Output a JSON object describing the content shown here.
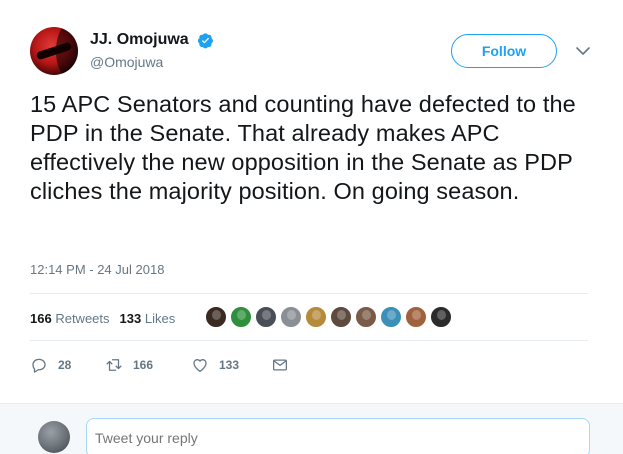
{
  "user": {
    "display_name": "JJ. Omojuwa",
    "handle": "@Omojuwa",
    "verified": true
  },
  "follow_label": "Follow",
  "tweet": {
    "text": "15 APC Senators and counting have defected to the PDP in the Senate. That already makes APC effectively the new opposition in the Senate as PDP cliches the majority position. On going season.",
    "timestamp": "12:14 PM - 24 Jul 2018"
  },
  "stats": {
    "retweets_count": "166",
    "retweets_label": "Retweets",
    "likes_count": "133",
    "likes_label": "Likes"
  },
  "liker_faces": [
    {
      "color": "#3a2a22"
    },
    {
      "color": "#2f8f3c"
    },
    {
      "color": "#4a4f57"
    },
    {
      "color": "#8a8f96"
    },
    {
      "color": "#b58a3a"
    },
    {
      "color": "#5e4a3f"
    },
    {
      "color": "#7a5b48"
    },
    {
      "color": "#3b8fb8"
    },
    {
      "color": "#a0623d"
    },
    {
      "color": "#2b2b2b"
    }
  ],
  "actions": {
    "reply_count": "28",
    "retweet_count": "166",
    "like_count": "133"
  },
  "reply_box": {
    "placeholder": "Tweet your reply"
  },
  "colors": {
    "accent": "#1da1f2",
    "text": "#14171a",
    "secondary": "#657786"
  }
}
